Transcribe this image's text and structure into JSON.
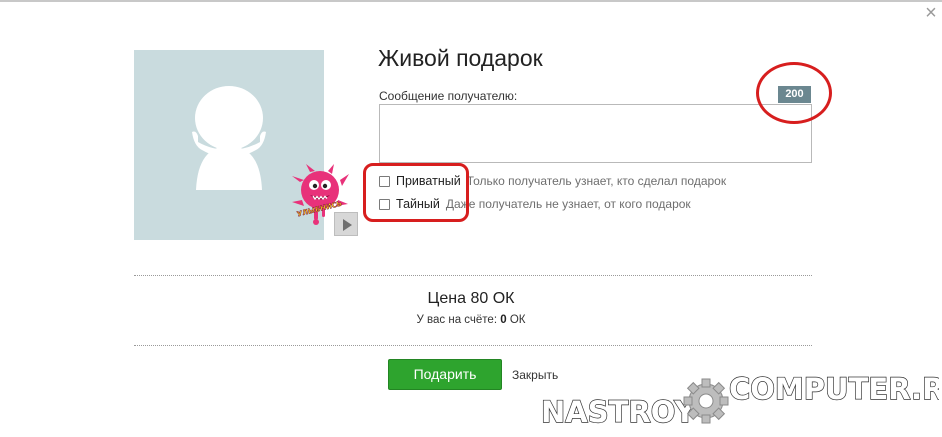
{
  "dialog": {
    "title": "Живой подарок",
    "message_label": "Сообщение получателю:",
    "message_value": "",
    "char_counter": "200",
    "options": [
      {
        "label": "Приватный",
        "hint": "Только получатель узнает, кто сделал подарок",
        "checked": false
      },
      {
        "label": "Тайный",
        "hint": "Даже получатель не узнает, от кого подарок",
        "checked": false
      }
    ],
    "sticker_caption": "УЛЫБНИСЬ",
    "price_prefix": "Цена",
    "price_value": "80 ОК",
    "balance_label": "У вас на счёте:",
    "balance_value": "0",
    "balance_unit": "ОК",
    "gift_button": "Подарить",
    "close_link": "Закрыть",
    "close_icon": "×"
  },
  "watermark": {
    "left": "NASTROY",
    "right": "COMPUTER.RU"
  },
  "colors": {
    "accent_green": "#2ea42e",
    "counter_bg": "#6b8790",
    "avatar_bg": "#c9dbde",
    "annotation_red": "#d71e1e"
  },
  "icons": [
    "close-icon",
    "avatar-silhouette-icon",
    "play-icon",
    "checkbox-icon",
    "gear-icon"
  ]
}
